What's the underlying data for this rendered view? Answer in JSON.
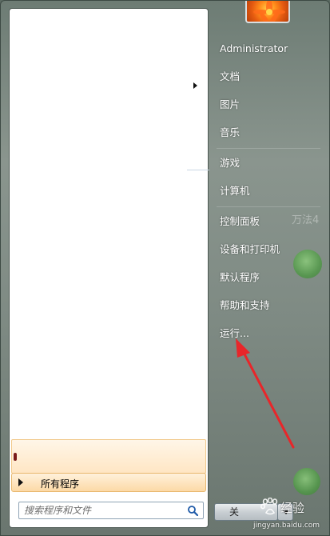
{
  "right_column": {
    "username": "Administrator",
    "documents": "文档",
    "pictures": "图片",
    "music": "音乐",
    "games": "游戏",
    "computer": "计算机",
    "control_panel": "控制面板",
    "devices_printers": "设备和打印机",
    "default_programs": "默认程序",
    "help_support": "帮助和支持",
    "run": "运行..."
  },
  "left_pane": {
    "all_programs": "所有程序",
    "search_placeholder": "搜索程序和文件"
  },
  "shutdown": {
    "label": "关"
  },
  "background": {
    "ghost_text": "万法4"
  },
  "watermark": {
    "text": "经验",
    "url": "jingyan.baidu.com"
  },
  "colors": {
    "annotation_arrow": "#e8262a",
    "menu_frame": "#7e8a83",
    "left_pane": "#ffffff"
  },
  "icons": {
    "avatar": "orange-flower-picture",
    "search": "magnifier-icon",
    "shutdown_menu": "triangle-down-icon",
    "all_programs": "triangle-right-icon"
  }
}
